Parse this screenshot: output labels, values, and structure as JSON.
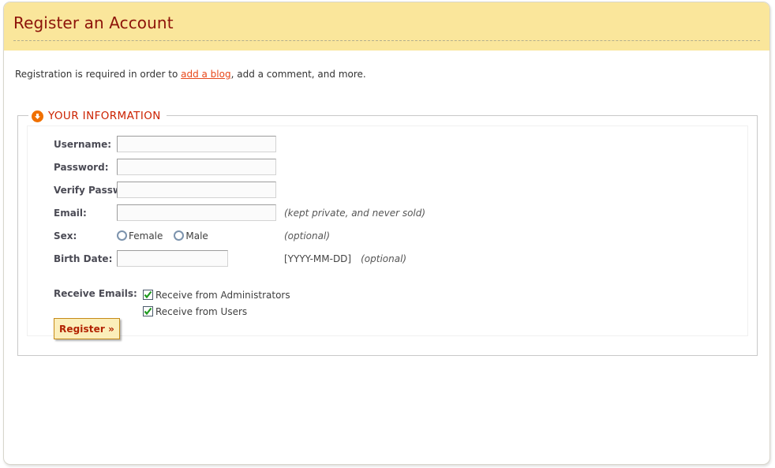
{
  "header": {
    "title": "Register an Account"
  },
  "intro": {
    "prefix": "Registration is required in order to ",
    "link_text": "add a blog",
    "suffix": ", add a comment, and more."
  },
  "section": {
    "legend": "YOUR INFORMATION",
    "icon": "down-arrow-circle-icon"
  },
  "form": {
    "fields": [
      {
        "label": "Username:",
        "value": "",
        "placeholder": "",
        "hint": ""
      },
      {
        "label": "Password:",
        "value": "",
        "placeholder": "",
        "hint": ""
      },
      {
        "label": "Verify Password:",
        "value": "",
        "placeholder": "",
        "hint": ""
      },
      {
        "label": "Email:",
        "value": "",
        "placeholder": "",
        "hint": "(kept private, and never sold)"
      }
    ],
    "sex": {
      "label": "Sex:",
      "hint": "(optional)",
      "options": [
        {
          "label": "Female",
          "selected": false
        },
        {
          "label": "Male",
          "selected": false
        }
      ]
    },
    "birth_date": {
      "label": "Birth Date:",
      "value": "",
      "placeholder": "",
      "format_hint": "[YYYY-MM-DD]",
      "optional_hint": "(optional)"
    },
    "receive_emails": {
      "label": "Receive Emails:",
      "options": [
        {
          "label": "Receive from Administrators",
          "checked": true
        },
        {
          "label": "Receive from Users",
          "checked": true
        }
      ]
    },
    "submit_label": "Register »"
  },
  "colors": {
    "banner": "#fae69b",
    "title": "#8d1309",
    "link": "#e8481a",
    "legend": "#cc2200",
    "icon": "#f07000",
    "button_bg": "#fbeeba",
    "button_border": "#c58a18",
    "button_text": "#b22200",
    "check": "#1f9a1f"
  }
}
